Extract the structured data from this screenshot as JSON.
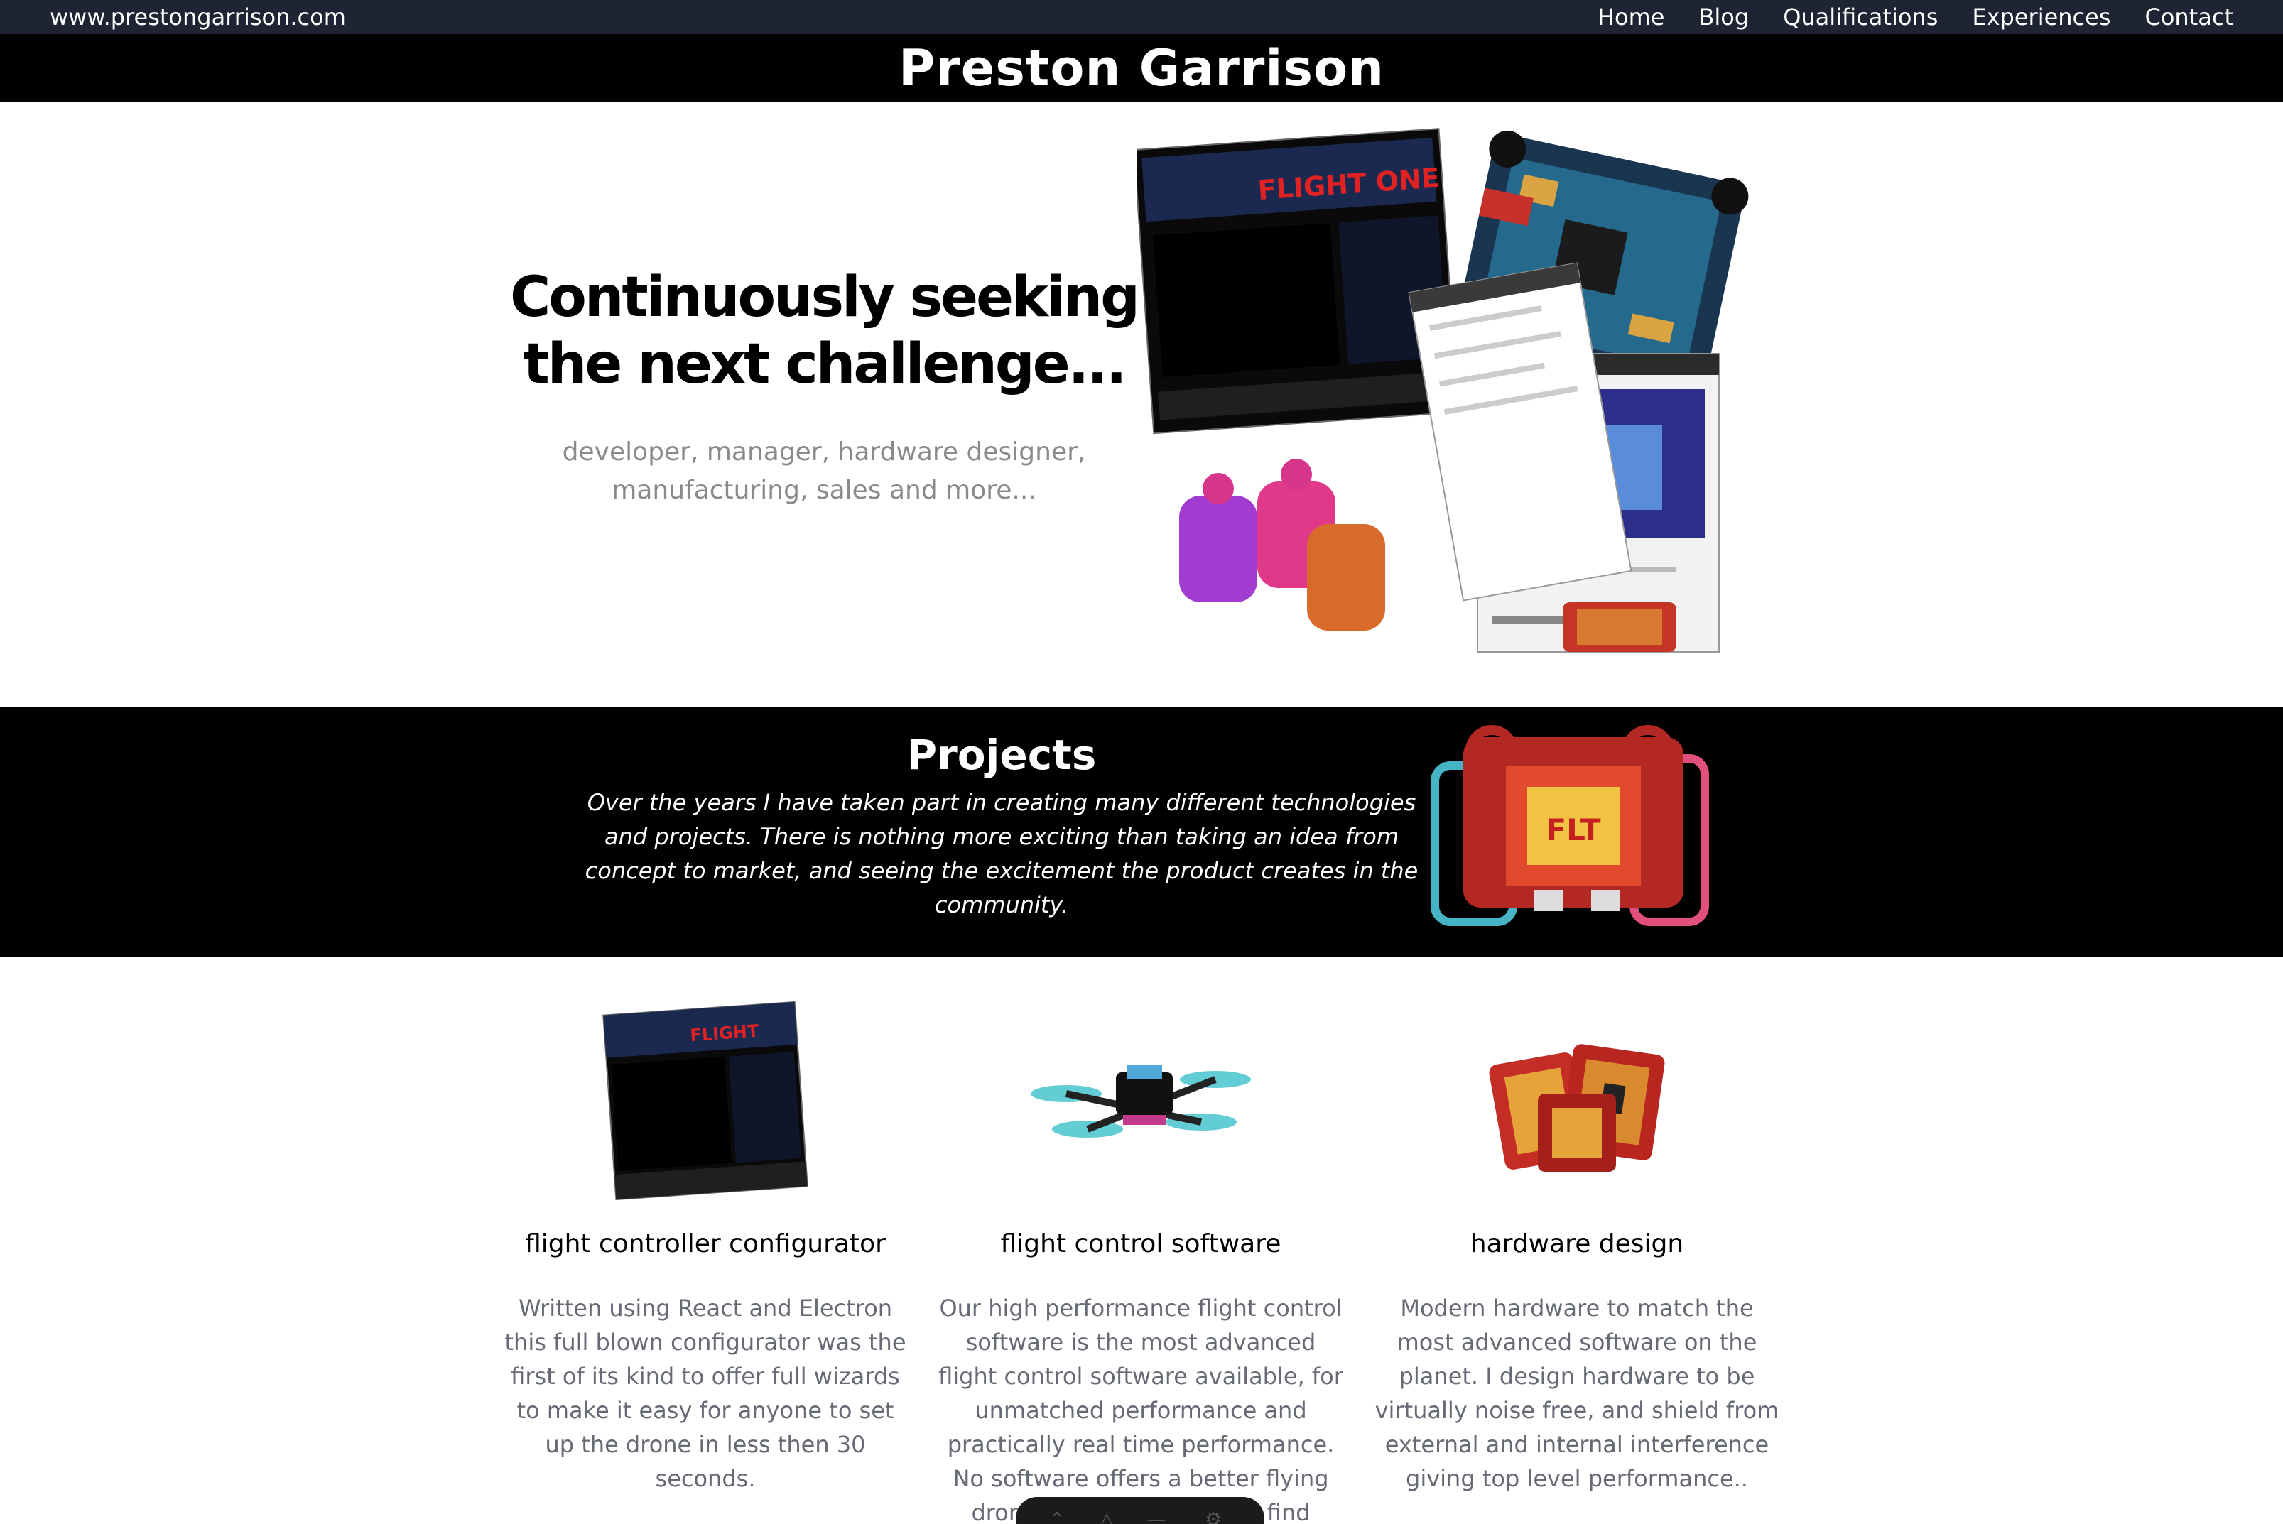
{
  "nav": {
    "site_url": "www.prestongarrison.com",
    "links": [
      "Home",
      "Blog",
      "Qualifications",
      "Experiences",
      "Contact"
    ]
  },
  "title": "Preston Garrison",
  "hero": {
    "heading_line1": "Continuously seeking",
    "heading_line2": "the next challenge...",
    "sub_line1": "developer, manager, hardware designer,",
    "sub_line2": "manufacturing, sales and more..."
  },
  "projects": {
    "title": "Projects",
    "description": "Over the years I have taken part in creating many different technologies and projects. There is nothing more exciting than taking an idea from concept to market, and seeing the excitement the product creates in the community."
  },
  "cards": [
    {
      "title": "flight controller configurator",
      "text": "Written using React and Electron this full blown configurator was the first of its kind to offer full wizards to make it easy for anyone to set up the drone in less then 30 seconds."
    },
    {
      "title": "flight control software",
      "text": "Our high performance flight control software is the most advanced flight control software available, for unmatched performance and practically real time performance. No software offers a better flying drone, than what you will find here..."
    },
    {
      "title": "hardware design",
      "text": "Modern hardware to match the most advanced software on the planet. I design hardware to be virtually noise free, and shield from external and internal interference giving top level performance.."
    }
  ],
  "image_labels": {
    "flightone_logo": "FLIGHT ONE",
    "flightone_logo_small": "FLIGHT",
    "fc_board_label": "FLT"
  },
  "colors": {
    "nav_bg": "#1e2433",
    "title_bg": "#000000",
    "accent_red": "#d92a2a",
    "teal": "#46b4c4",
    "pink": "#e0507a",
    "muted_text": "#8a8a8a"
  },
  "icons": [
    "chevron-up-icon",
    "bell-icon",
    "minus-icon",
    "settings-icon"
  ]
}
